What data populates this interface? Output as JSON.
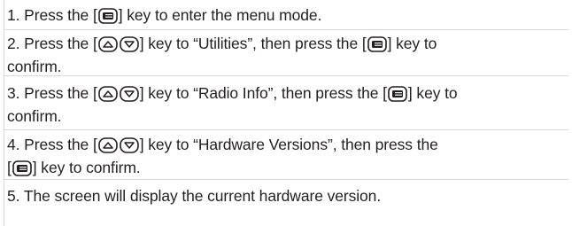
{
  "steps": [
    {
      "number": "1.",
      "parts": [
        "Press the [",
        "] key to enter the menu mode."
      ]
    },
    {
      "number": "2.",
      "parts": [
        "Press the [",
        "] key to “Utilities”, then press the [",
        "] key to",
        "confirm."
      ]
    },
    {
      "number": "3.",
      "parts": [
        "Press the [",
        "] key to “Radio Info”, then press the [",
        "] key to",
        "confirm."
      ]
    },
    {
      "number": "4.",
      "parts": [
        "Press the [",
        "] key to “Hardware Versions”, then press the",
        "[",
        "] key to confirm."
      ]
    },
    {
      "number": "5.",
      "parts": [
        "The screen will display the current hardware version."
      ]
    }
  ],
  "icons": {
    "menu_key": "menu-key-icon",
    "up_key": "up-arrow-key-icon",
    "down_key": "down-arrow-key-icon"
  }
}
